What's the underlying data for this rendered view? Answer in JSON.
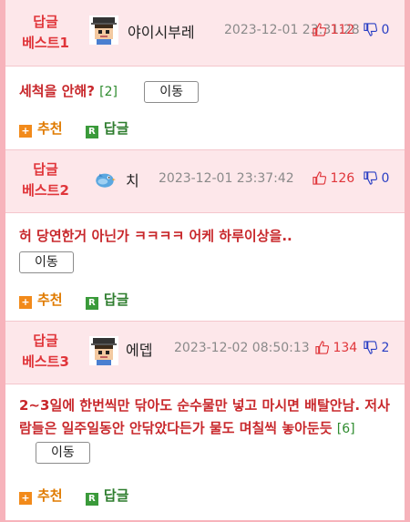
{
  "posts": [
    {
      "badge": [
        "답글",
        "베스트1"
      ],
      "nickname": "야이시부레",
      "datetime": "2023-12-01 23:31:28",
      "up": "112",
      "down": "0",
      "content": "세척을 안해?",
      "reply_count": "[2]",
      "move_label": "이동",
      "recommend_label": "추천",
      "reply_label": "답글",
      "avatar": "pixel-avatar-capped"
    },
    {
      "badge": [
        "답글",
        "베스트2"
      ],
      "nickname": "치",
      "datetime": "2023-12-01 23:37:42",
      "up": "126",
      "down": "0",
      "content": "허 당연한거 아닌가 ㅋㅋㅋㅋ 어케 하루이상을..",
      "reply_count": "",
      "move_label": "이동",
      "recommend_label": "추천",
      "reply_label": "답글",
      "avatar": "blue-bird"
    },
    {
      "badge": [
        "답글",
        "베스트3"
      ],
      "nickname": "에뎁",
      "datetime": "2023-12-02 08:50:13",
      "up": "134",
      "down": "2",
      "content": "2~3일에 한번씩만 닦아도 순수물만 넣고 마시면 배탈안남. 저사람들은 일주일동안 안닦았다든가 물도 며칠씩 놓아둔듯",
      "reply_count": "[6]",
      "move_label": "이동",
      "recommend_label": "추천",
      "reply_label": "답글",
      "avatar": "pixel-avatar-capped"
    }
  ],
  "colors": {
    "accent_red": "#e0353a",
    "down_blue": "#2a3fc4",
    "header_bg": "#fde7ea",
    "frame": "#f7b3bb"
  }
}
